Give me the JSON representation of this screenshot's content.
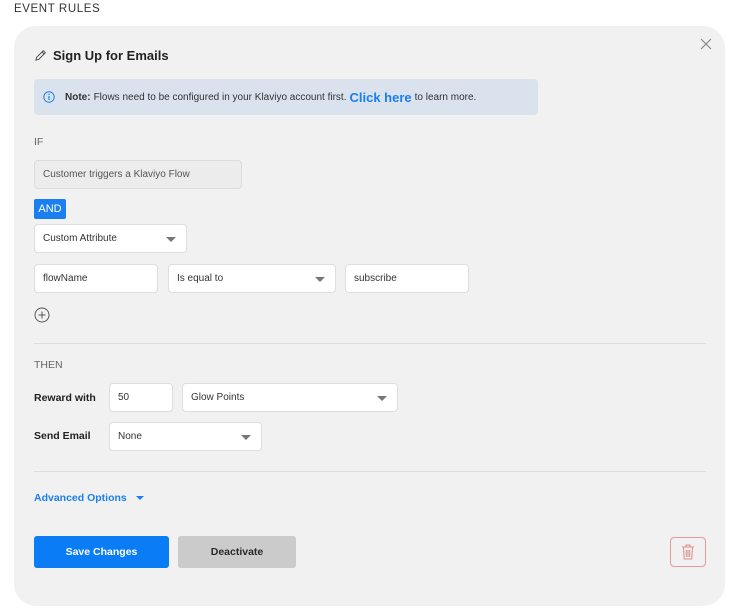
{
  "page": {
    "section_heading": "EVENT RULES"
  },
  "rule": {
    "title": "Sign Up for Emails",
    "note": {
      "label": "Note:",
      "text": "Flows need to be configured in your Klaviyo account first.",
      "link": "Click here",
      "suffix": "to learn more."
    },
    "if_label": "IF",
    "trigger": "Customer triggers a Klaviyo Flow",
    "and_label": "AND",
    "condition_type": "Custom Attribute",
    "condition": {
      "attribute": "flowName",
      "operator": "Is equal to",
      "value": "subscribe"
    },
    "then_label": "THEN",
    "reward": {
      "label": "Reward with",
      "amount": "50",
      "currency": "Glow Points"
    },
    "email": {
      "label": "Send Email",
      "value": "None"
    },
    "advanced_options": "Advanced Options",
    "buttons": {
      "save": "Save Changes",
      "deactivate": "Deactivate"
    }
  },
  "colors": {
    "accent": "#0a7cf5",
    "danger": "#e29c9c",
    "card_bg": "#f1f1f1",
    "note_bg": "#d9e2ed"
  }
}
